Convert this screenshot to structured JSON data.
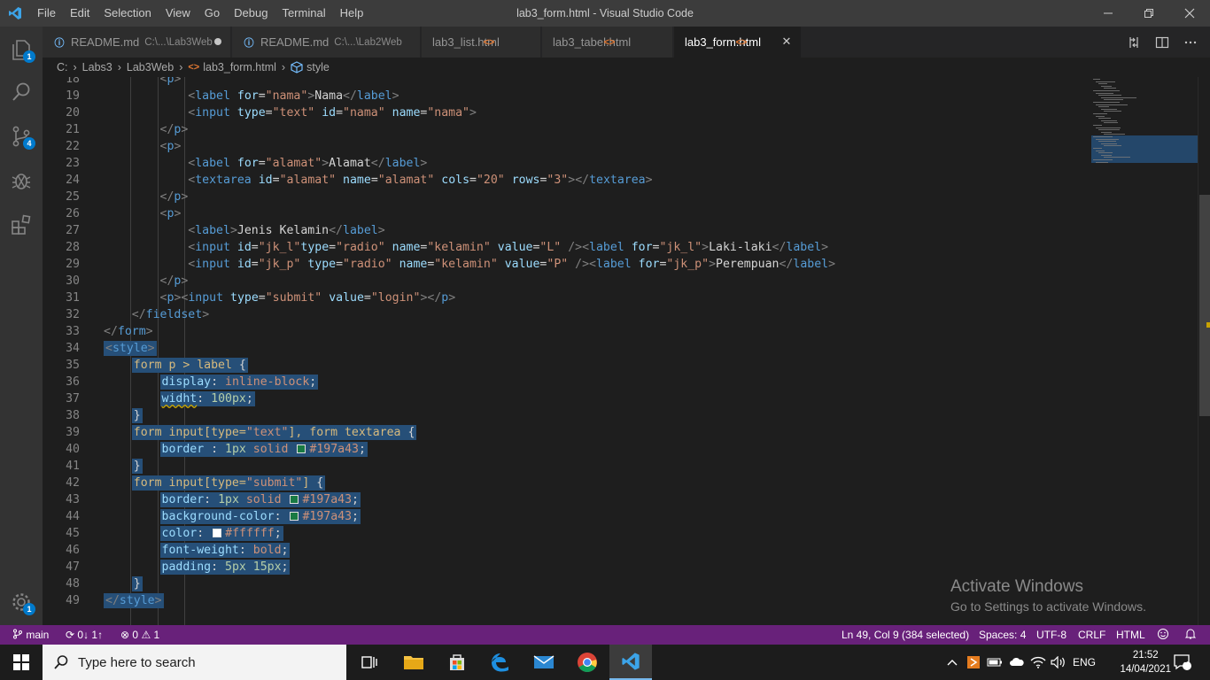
{
  "titlebar": {
    "menu": [
      "File",
      "Edit",
      "Selection",
      "View",
      "Go",
      "Debug",
      "Terminal",
      "Help"
    ],
    "title": "lab3_form.html - Visual Studio Code"
  },
  "activity": {
    "explorer_badge": "1",
    "scm_badge": "4",
    "settings_badge": "1"
  },
  "tabs": [
    {
      "label": "README.md",
      "dir": "C:\\...\\Lab3Web",
      "icon": "info-icon",
      "dirty": true
    },
    {
      "label": "README.md",
      "dir": "C:\\...\\Lab2Web",
      "icon": "info-icon"
    },
    {
      "label": "lab3_list.html",
      "icon": "html-icon"
    },
    {
      "label": "lab3_tabel.html",
      "icon": "html-icon"
    },
    {
      "label": "lab3_form.html",
      "icon": "html-icon",
      "active": true
    }
  ],
  "tab_icons": {
    "info": "ⓘ",
    "code": "<>"
  },
  "breadcrumb": [
    "C:",
    "Labs3",
    "Lab3Web",
    "lab3_form.html",
    "style"
  ],
  "editor": {
    "first_line_partial": "18",
    "lines": [
      {
        "n": "18",
        "indent": 8,
        "html": "<p>"
      },
      {
        "n": "19",
        "indent": 12
      },
      {
        "n": "20",
        "indent": 12
      },
      {
        "n": "21",
        "indent": 8
      },
      {
        "n": "22",
        "indent": 8
      },
      {
        "n": "23",
        "indent": 12
      },
      {
        "n": "24",
        "indent": 12
      },
      {
        "n": "25",
        "indent": 8
      },
      {
        "n": "26",
        "indent": 8
      },
      {
        "n": "27",
        "indent": 12
      },
      {
        "n": "28",
        "indent": 12
      },
      {
        "n": "29",
        "indent": 12
      },
      {
        "n": "30",
        "indent": 8
      },
      {
        "n": "31",
        "indent": 8
      },
      {
        "n": "32",
        "indent": 4
      },
      {
        "n": "33",
        "indent": 0
      },
      {
        "n": "34",
        "indent": 0
      },
      {
        "n": "35",
        "indent": 4
      },
      {
        "n": "36",
        "indent": 8
      },
      {
        "n": "37",
        "indent": 8
      },
      {
        "n": "38",
        "indent": 4
      },
      {
        "n": "39",
        "indent": 4
      },
      {
        "n": "40",
        "indent": 8
      },
      {
        "n": "41",
        "indent": 4
      },
      {
        "n": "42",
        "indent": 4
      },
      {
        "n": "43",
        "indent": 8
      },
      {
        "n": "44",
        "indent": 8
      },
      {
        "n": "45",
        "indent": 8
      },
      {
        "n": "46",
        "indent": 8
      },
      {
        "n": "47",
        "indent": 8
      },
      {
        "n": "48",
        "indent": 4
      },
      {
        "n": "49",
        "indent": 0
      }
    ],
    "colors": {
      "green": "#197a43",
      "white": "#ffffff",
      "selection": "#264f78"
    }
  },
  "watermark": {
    "title": "Activate Windows",
    "subtitle": "Go to Settings to activate Windows."
  },
  "statusbar": {
    "branch": "main",
    "sync": "0↓ 1↑",
    "errors": "0",
    "warnings": "1",
    "position": "Ln 49, Col 9 (384 selected)",
    "spaces": "Spaces: 4",
    "encoding": "UTF-8",
    "eol": "CRLF",
    "language": "HTML",
    "background": "#68217a"
  },
  "taskbar": {
    "search_placeholder": "Type here to search",
    "language": "ENG",
    "time": "21:52",
    "date": "14/04/2021",
    "notifications": "9"
  }
}
